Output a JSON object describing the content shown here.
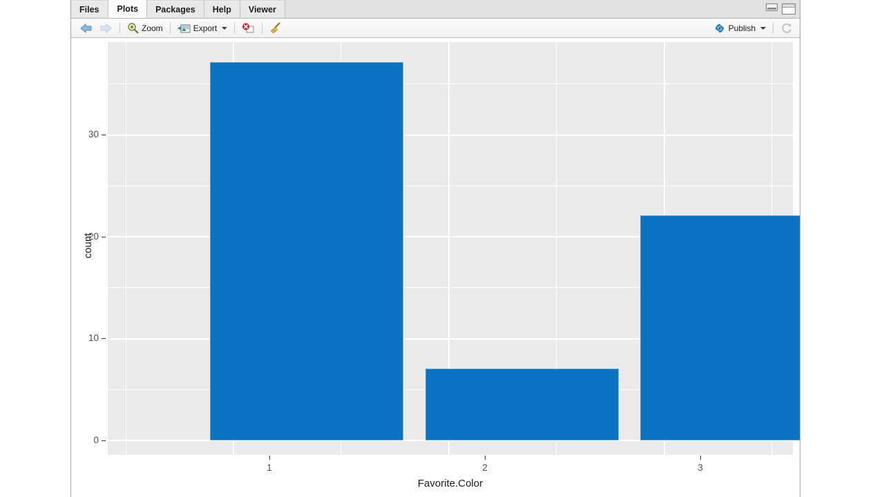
{
  "window": {
    "minimize_icon": "minimize-icon",
    "maximize_icon": "maximize-icon"
  },
  "tabs": [
    {
      "label": "Files",
      "active": false
    },
    {
      "label": "Plots",
      "active": true
    },
    {
      "label": "Packages",
      "active": false
    },
    {
      "label": "Help",
      "active": false
    },
    {
      "label": "Viewer",
      "active": false
    }
  ],
  "toolbar": {
    "back_icon": "back-arrow-icon",
    "forward_icon": "forward-arrow-icon",
    "zoom_label": "Zoom",
    "zoom_icon": "magnifier-plus-icon",
    "export_label": "Export",
    "export_icon": "export-image-icon",
    "export_caret": "chevron-down-icon",
    "remove_icon": "remove-plot-icon",
    "clear_icon": "broom-clear-icon",
    "publish_label": "Publish",
    "publish_icon": "publish-icon",
    "publish_caret": "chevron-down-icon",
    "refresh_icon": "refresh-icon"
  },
  "colors": {
    "bar_fill": "#0b72c2",
    "bar_stroke": "#5fa8dc",
    "panel_bg": "#ebebeb",
    "gridline": "#ffffff",
    "tick_text": "#4d4d4d",
    "axis_title": "#1a1a1a"
  },
  "chart_data": {
    "type": "bar",
    "title": "",
    "categories": [
      "1",
      "2",
      "3"
    ],
    "values": [
      37,
      7,
      22
    ],
    "series": [
      {
        "name": "count",
        "values": [
          37,
          7,
          22
        ]
      }
    ],
    "xlabel": "Favorite.Color",
    "ylabel": "count",
    "ylim": [
      0,
      38.9
    ],
    "xtick_labels": [
      "1",
      "2",
      "3"
    ],
    "ytick_labels": [
      "0",
      "10",
      "20",
      "30"
    ],
    "ytick_values": [
      0,
      10,
      20,
      30
    ],
    "yminor_values": [
      5,
      15,
      25,
      35
    ],
    "grid": true,
    "legend": "none",
    "theme": "theme_grey"
  }
}
